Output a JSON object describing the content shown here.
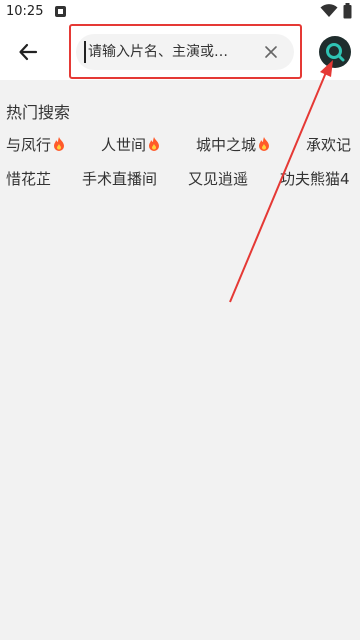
{
  "status_bar": {
    "time": "10:25",
    "icons": [
      "notification-icon",
      "wifi-icon",
      "battery-icon"
    ]
  },
  "toolbar": {
    "back_icon": "arrow-left-icon",
    "search": {
      "placeholder": "请输入片名、主演或…",
      "value": ""
    },
    "clear_icon": "close-icon",
    "search_icon": "search-icon"
  },
  "hot_search": {
    "title": "热门搜索",
    "items": [
      {
        "label": "与凤行",
        "hot": true
      },
      {
        "label": "人世间",
        "hot": true
      },
      {
        "label": "城中之城",
        "hot": true
      },
      {
        "label": "承欢记",
        "hot": false
      },
      {
        "label": "惜花芷",
        "hot": false
      },
      {
        "label": "手术直播间",
        "hot": false
      },
      {
        "label": "又见逍遥",
        "hot": false
      },
      {
        "label": "功夫熊猫4",
        "hot": false
      }
    ]
  },
  "colors": {
    "accent_red": "#e53935",
    "search_button_bg": "#1f2d2d",
    "search_button_ring": "#2fc4b4",
    "fire": "#ff5a2b",
    "background": "#f2f2f2"
  }
}
